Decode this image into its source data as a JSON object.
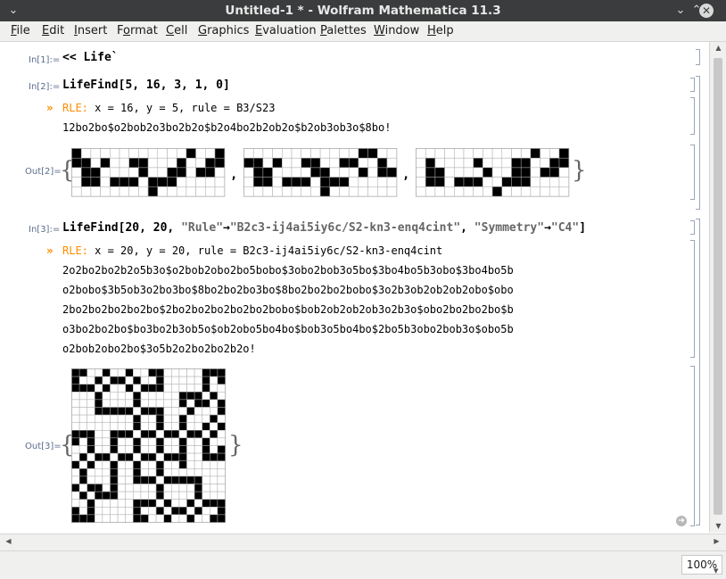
{
  "window": {
    "title": "Untitled-1 * - Wolfram Mathematica 11.3"
  },
  "menu": [
    {
      "label": "File",
      "mn": "F",
      "rest": "ile"
    },
    {
      "label": "Edit",
      "mn": "E",
      "rest": "dit"
    },
    {
      "label": "Insert",
      "mn": "I",
      "rest": "nsert"
    },
    {
      "label": "Format",
      "mn": "F",
      "rest": "ormat",
      "pre": ""
    },
    {
      "label": "Cell",
      "mn": "C",
      "rest": "ell"
    },
    {
      "label": "Graphics",
      "mn": "G",
      "rest": "raphics"
    },
    {
      "label": "Evaluation",
      "mn": "E",
      "rest": "valuation"
    },
    {
      "label": "Palettes",
      "mn": "P",
      "rest": "alettes"
    },
    {
      "label": "Window",
      "mn": "W",
      "rest": "indow"
    },
    {
      "label": "Help",
      "mn": "H",
      "rest": "elp"
    }
  ],
  "cells": {
    "in1": {
      "label": "In[1]:=",
      "code": "<< Life`"
    },
    "in2": {
      "label": "In[2]:=",
      "code": "LifeFind[5, 16, 3, 1, 0]"
    },
    "print2": {
      "head_key": "RLE:",
      "head_rest": " x = 16, y = 5, rule = B3/S23",
      "lines": [
        "12bo2bo$o2bob2o3bo2b2o$b2o4bo2b2ob2o$b2ob3ob3o$8bo!"
      ]
    },
    "out2": {
      "label": "Out[2]="
    },
    "in3": {
      "label": "In[3]:=",
      "code_a": "LifeFind[20, 20, ",
      "str1": "\"Rule\"",
      "arrow": "→",
      "str2": "\"B2c3-ij4ai5iy6c/S2-kn3-enq4cint\"",
      "comma": ", ",
      "str3": "\"Symmetry\"",
      "str4": "\"C4\"",
      "close": "]"
    },
    "print3": {
      "head_key": "RLE:",
      "head_rest": " x = 20, y = 20, rule = B2c3-ij4ai5iy6c/S2-kn3-enq4cint",
      "lines": [
        "2o2bo2bo2b2o5b3o$o2bob2obo2bo5bobo$3obo2bob3o5bo$3bo4bo5b3obo$3bo4bo5b",
        "o2bobo$3b5ob3o2bo3bo$8bo2bo2bo3bo$8bo2bo2bo2bobo$3o2b3ob2ob2ob2obo$obo",
        "2bo2bo2bo2bo2bo$2bo2bo2bo2bo2bo2bobo$bob2ob2ob2ob3o2b3o$obo2bo2bo2bo$b",
        "o3bo2bo2bo$bo3bo2b3ob5o$ob2obo5bo4bo$bob3o5bo4bo$2bo5b3obo2bob3o$obo5b",
        "o2bob2obo2bo$3o5b2o2bo2bo2b2o!"
      ]
    },
    "out3": {
      "label": "Out[3]="
    }
  },
  "lifegrid_small": [
    "1000000000001001",
    "1101001100010011",
    "0110000100110110",
    "0110111011100000",
    "0000000010000000"
  ],
  "lifegrid_small_b": [
    "0000000000001100",
    "1101001100110010",
    "0110000110001011",
    "0110111011100000",
    "0000000010000000"
  ],
  "lifegrid_small_c": [
    "0000000000001001",
    "0100001000110011",
    "0110000100110110",
    "0110111001110000",
    "0000000010000000"
  ],
  "lifegrid_large": [
    "11001001001100000111",
    "10010110100100000101",
    "11101001011100000100",
    "00010000100000111010",
    "00010000100000101101",
    "00011111011100010001",
    "00000000100100100010",
    "00000000100100100101",
    "11100111011011011010",
    "10100100100100100100",
    "00100100100100100101",
    "01011011011011100111",
    "10100100100100100000",
    "01000100100100000000",
    "01000100111011111000",
    "10110100000100001000",
    "01011100000100001000",
    "00100000111010010111",
    "10100000100101101001",
    "11100000110010010011"
  ],
  "status": {
    "zoom": "100%"
  },
  "colors": {
    "chev": "#ff8c00",
    "label": "#5b6c8f",
    "titlebar": "#3b3c3d"
  }
}
